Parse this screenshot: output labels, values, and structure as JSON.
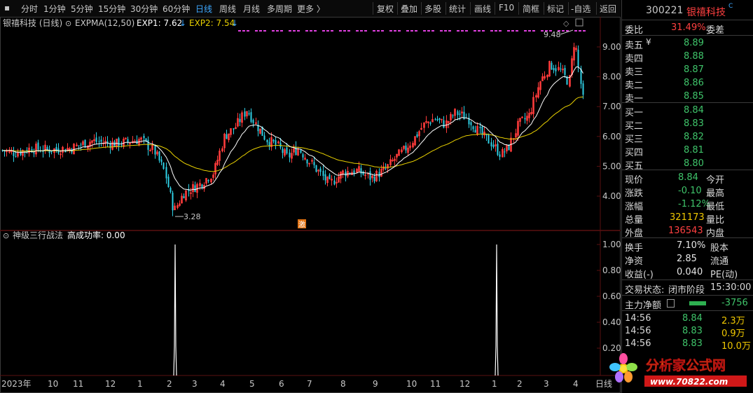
{
  "toolbar": {
    "items": [
      "分时",
      "1分钟",
      "5分钟",
      "15分钟",
      "30分钟",
      "60分钟",
      "日线",
      "周线",
      "月线",
      "多周期",
      "更多 〉"
    ],
    "active": "日线",
    "right_items": [
      "复权",
      "叠加",
      "多股",
      "统计",
      "画线",
      "F10",
      "简框",
      "标记",
      "-自选",
      "返回"
    ]
  },
  "main_panel": {
    "title": "银禧科技 (日线)",
    "indicator": "EXPMA(12,50)",
    "exp1_label": "EXP1: 7.62",
    "exp2_label": "EXP2: 7.54",
    "exp1_color": "#ffffff",
    "exp2_color": "#e8d000",
    "high_marker": "9.48",
    "low_marker": "3.28",
    "event_marker": "激",
    "y_ticks": [
      "9.00",
      "8.00",
      "7.00",
      "6.00",
      "5.00",
      "4.00"
    ]
  },
  "sub_panel": {
    "title": "神级三行战法",
    "metric": "高成功率: 0.00",
    "y_ticks": [
      "1.00",
      "0.80",
      "0.60",
      "0.40",
      "0.20"
    ]
  },
  "x_axis": {
    "labels": [
      "2023年",
      "10",
      "11",
      "12",
      "1",
      "2",
      "3",
      "4",
      "5",
      "6",
      "7",
      "8",
      "9",
      "10",
      "11",
      "12",
      "1",
      "2",
      "3",
      "4",
      "日线"
    ]
  },
  "quote": {
    "code": "300221",
    "name": "银禧科技",
    "weibi_label": "委比",
    "weibi_value": "31.49%",
    "weicha_label": "委差",
    "asks": [
      {
        "label": "卖五",
        "price": "8.89"
      },
      {
        "label": "卖四",
        "price": "8.88"
      },
      {
        "label": "卖三",
        "price": "8.87"
      },
      {
        "label": "卖二",
        "price": "8.86"
      },
      {
        "label": "卖一",
        "price": "8.85"
      }
    ],
    "bids": [
      {
        "label": "买一",
        "price": "8.84"
      },
      {
        "label": "买二",
        "price": "8.83"
      },
      {
        "label": "买三",
        "price": "8.82"
      },
      {
        "label": "买四",
        "price": "8.81"
      },
      {
        "label": "买五",
        "price": "8.80"
      }
    ],
    "stats": [
      {
        "l": "现价",
        "v": "8.84",
        "r": "今开",
        "vc": "green"
      },
      {
        "l": "涨跌",
        "v": "-0.10",
        "r": "最高",
        "vc": "green"
      },
      {
        "l": "涨幅",
        "v": "-1.12%",
        "r": "最低",
        "vc": "green"
      },
      {
        "l": "总量",
        "v": "321173",
        "r": "量比",
        "vc": "yellow"
      },
      {
        "l": "外盘",
        "v": "136543",
        "r": "内盘",
        "vc": "red"
      }
    ],
    "stats2": [
      {
        "l": "换手",
        "v": "7.10%",
        "r": "股本"
      },
      {
        "l": "净资",
        "v": "2.85",
        "r": "流通"
      },
      {
        "l": "收益(-)",
        "v": "0.040",
        "r": "PE(动)"
      }
    ],
    "trade_status_label": "交易状态:",
    "trade_status_value": "闭市阶段",
    "trade_time": "15:30:00",
    "main_flow_label": "主力净额",
    "main_flow_value": "-3756",
    "ticks": [
      {
        "t": "14:56",
        "p": "8.84",
        "v": "2.3万"
      },
      {
        "t": "14:56",
        "p": "8.83",
        "v": "0.9万"
      },
      {
        "t": "14:56",
        "p": "8.83",
        "v": "10.0万"
      }
    ]
  },
  "watermark": {
    "text": "分析家公式网",
    "url": "www.70822.com"
  }
}
